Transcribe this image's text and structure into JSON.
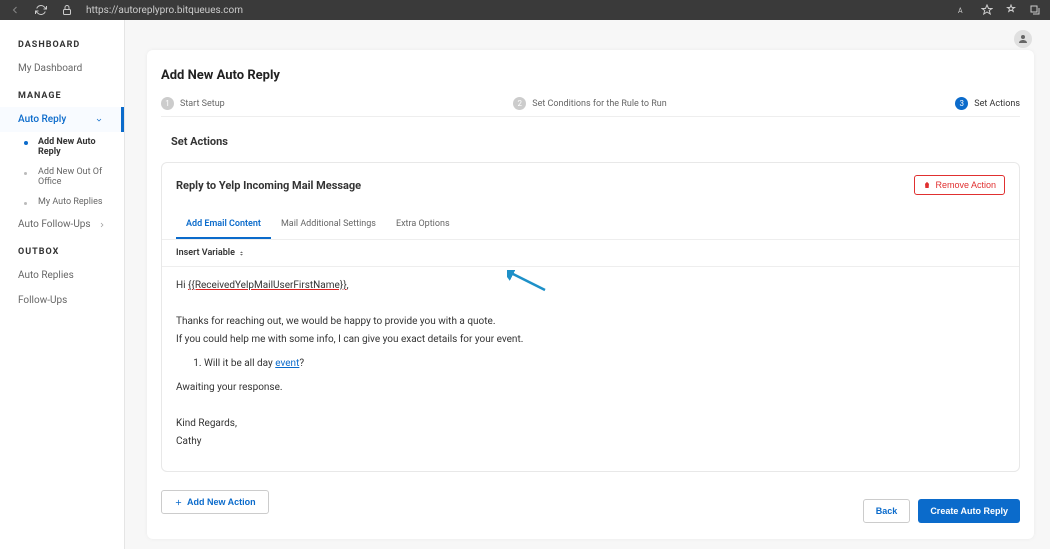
{
  "browser": {
    "url": "https://autoreplypro.bitqueues.com"
  },
  "sidebar": {
    "sections": {
      "dashboard": {
        "label": "DASHBOARD",
        "items": {
          "my_dashboard": "My Dashboard"
        }
      },
      "manage": {
        "label": "MANAGE",
        "auto_reply": "Auto Reply",
        "sub": {
          "add_auto_reply": "Add New Auto Reply",
          "add_ooo": "Add New Out Of Office",
          "my_auto_replies": "My Auto Replies"
        },
        "auto_followups": "Auto Follow-Ups"
      },
      "outbox": {
        "label": "OUTBOX",
        "auto_replies": "Auto Replies",
        "followups": "Follow-Ups"
      }
    }
  },
  "page": {
    "title": "Add New Auto Reply"
  },
  "steps": {
    "s1": {
      "num": "1",
      "label": "Start Setup"
    },
    "s2": {
      "num": "2",
      "label": "Set Conditions for the Rule to Run"
    },
    "s3": {
      "num": "3",
      "label": "Set Actions"
    }
  },
  "section_title": "Set Actions",
  "action": {
    "title": "Reply to Yelp Incoming Mail Message",
    "remove_label": "Remove Action",
    "tabs": {
      "content": "Add Email Content",
      "mail": "Mail Additional Settings",
      "extra": "Extra Options"
    },
    "toolbar_insert": "Insert Variable",
    "body": {
      "greeting_prefix": "Hi ",
      "variable": "{{ReceivedYelpMailUserFirstName}}",
      "greeting_suffix": ",",
      "p1": "Thanks for reaching out, we would be happy to provide you with a quote.",
      "p2": "If you could help me with some info, I can give you exact details for your event.",
      "li_prefix": "Will it be all day ",
      "li_link": "event",
      "li_suffix": "?",
      "await": "Awaiting your response.",
      "regards": "Kind Regards,",
      "name": "Cathy"
    }
  },
  "buttons": {
    "add_action": "Add New Action",
    "back": "Back",
    "create": "Create Auto Reply"
  }
}
